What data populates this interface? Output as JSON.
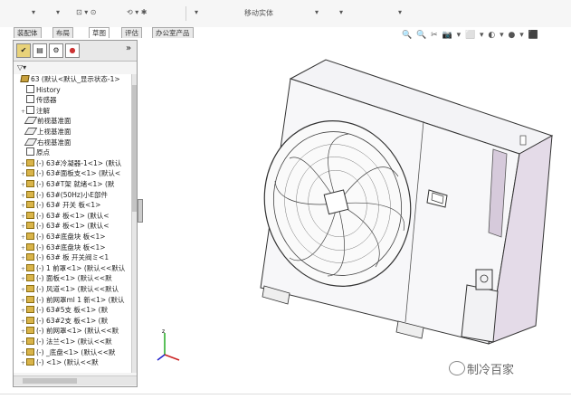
{
  "toolbar": {
    "items": [
      "▾",
      "▾",
      "⊡ ▾ ⊙",
      "⟲ ▾ ✱",
      "▾",
      "移动实体",
      "▾",
      "▾",
      "▾"
    ]
  },
  "tabs": [
    {
      "label": "装配体"
    },
    {
      "label": "布局"
    },
    {
      "label": "草图"
    },
    {
      "label": "评估"
    },
    {
      "label": "办公室产品"
    }
  ],
  "panel": {
    "filter_label": "▽▾",
    "expand_label": "»",
    "tree": [
      {
        "label": "63 (默认<默认_显示状态-1>",
        "icon": "assembly-icon",
        "expander": "",
        "indent": 0
      },
      {
        "label": "History",
        "icon": "history-icon",
        "expander": "",
        "indent": 1
      },
      {
        "label": "传感器",
        "icon": "sensor-icon",
        "expander": "",
        "indent": 1
      },
      {
        "label": "注解",
        "icon": "annotation-icon",
        "expander": "+",
        "indent": 1
      },
      {
        "label": "前视基准面",
        "icon": "plane-icon",
        "expander": "",
        "indent": 1
      },
      {
        "label": "上视基准面",
        "icon": "plane-icon",
        "expander": "",
        "indent": 1
      },
      {
        "label": "右视基准面",
        "icon": "plane-icon",
        "expander": "",
        "indent": 1
      },
      {
        "label": "原点",
        "icon": "origin-icon",
        "expander": "",
        "indent": 1
      },
      {
        "label": "(-) 63#冷凝器-1<1> (默认",
        "icon": "part-icon",
        "expander": "+",
        "indent": 1
      },
      {
        "label": "(-) 63#面板支<1> (默认<",
        "icon": "part-icon",
        "expander": "+",
        "indent": 1
      },
      {
        "label": "(-) 63#T架  就绪<1> (默",
        "icon": "part-icon",
        "expander": "+",
        "indent": 1
      },
      {
        "label": "(-) 63#(50Hz)小E部件",
        "icon": "part-icon",
        "expander": "+",
        "indent": 1
      },
      {
        "label": "(-) 63#  开关  板<1>",
        "icon": "part-icon",
        "expander": "+",
        "indent": 1
      },
      {
        "label": "(-) 63#    板<1> (默认<",
        "icon": "part-icon",
        "expander": "+",
        "indent": 1
      },
      {
        "label": "(-) 63#    板<1> (默认<",
        "icon": "part-icon",
        "expander": "+",
        "indent": 1
      },
      {
        "label": "(-) 63#底盘块    板<1>",
        "icon": "part-icon",
        "expander": "+",
        "indent": 1
      },
      {
        "label": "(-) 63#底盘块    板<1>",
        "icon": "part-icon",
        "expander": "+",
        "indent": 1
      },
      {
        "label": "(-) 63#  板  开关阀ミ<1",
        "icon": "part-icon",
        "expander": "+",
        "indent": 1
      },
      {
        "label": "(-) 1 前罩<1> (默认<<默认",
        "icon": "part-icon",
        "expander": "+",
        "indent": 1
      },
      {
        "label": "(-)   面板<1> (默认<<默",
        "icon": "part-icon",
        "expander": "+",
        "indent": 1
      },
      {
        "label": "(-) 风道<1> (默认<<默认",
        "icon": "part-icon",
        "expander": "+",
        "indent": 1
      },
      {
        "label": "(-) 前网罩ml 1 新<1> (默认",
        "icon": "part-icon",
        "expander": "+",
        "indent": 1
      },
      {
        "label": "(-) 63#5支  板<1> (默",
        "icon": "part-icon",
        "expander": "+",
        "indent": 1
      },
      {
        "label": "(-) 63#2支  板<1> (默",
        "icon": "part-icon",
        "expander": "+",
        "indent": 1
      },
      {
        "label": "(-) 前网罩<1> (默认<<默",
        "icon": "part-icon",
        "expander": "+",
        "indent": 1
      },
      {
        "label": "(-)   法兰<1> (默认<<默",
        "icon": "part-icon",
        "expander": "+",
        "indent": 1
      },
      {
        "label": "(-)  _底盘<1> (默认<<默",
        "icon": "part-icon",
        "expander": "+",
        "indent": 1
      },
      {
        "label": "(-)     <1> (默认<<默",
        "icon": "part-icon",
        "expander": "+",
        "indent": 1
      }
    ]
  },
  "viewtools": "🔍 🔍 ✂ 📷 ▾ ⬜ ▾ ◐ ▾ ● ▾ ⬛",
  "watermark": "制冷百家"
}
